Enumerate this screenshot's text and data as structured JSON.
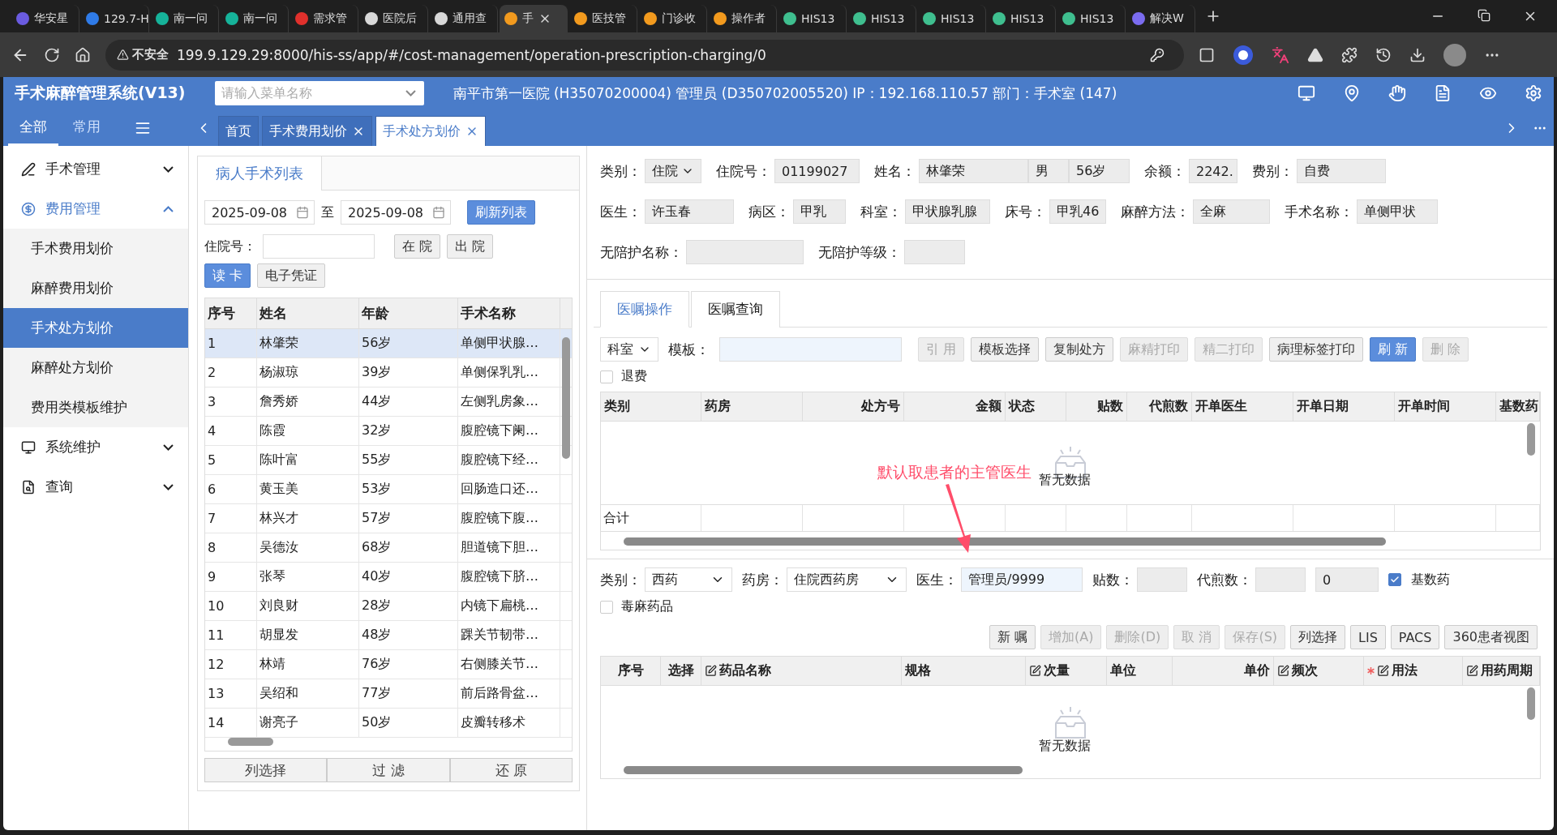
{
  "browser": {
    "tabs": [
      {
        "title": "华安星",
        "color": "#6a5be0",
        "selected": false
      },
      {
        "title": "129.7-H",
        "color": "#2f7be8",
        "selected": false
      },
      {
        "title": "南一问",
        "color": "#16b39a",
        "selected": false
      },
      {
        "title": "南一问",
        "color": "#16b39a",
        "selected": false
      },
      {
        "title": "需求管",
        "color": "#e0302c",
        "selected": false
      },
      {
        "title": "医院后",
        "color": "#d8d8d8",
        "selected": false
      },
      {
        "title": "通用查",
        "color": "#d8d8d8",
        "selected": false
      },
      {
        "title": "手",
        "color": "#f29a1e",
        "selected": true
      },
      {
        "title": "医技管",
        "color": "#f29a1e",
        "selected": false
      },
      {
        "title": "门诊收",
        "color": "#f29a1e",
        "selected": false
      },
      {
        "title": "操作者",
        "color": "#f29a1e",
        "selected": false
      },
      {
        "title": "HIS13",
        "color": "#3fbf8f",
        "selected": false
      },
      {
        "title": "HIS13",
        "color": "#3fbf8f",
        "selected": false
      },
      {
        "title": "HIS13",
        "color": "#3fbf8f",
        "selected": false
      },
      {
        "title": "HIS13",
        "color": "#3fbf8f",
        "selected": false
      },
      {
        "title": "HIS13",
        "color": "#3fbf8f",
        "selected": false
      },
      {
        "title": "解决W",
        "color": "#7b6cf0",
        "selected": false
      }
    ],
    "security": "不安全",
    "url": "199.9.129.29:8000/his-ss/app/#/cost-management/operation-prescription-charging/0"
  },
  "app": {
    "title": "手术麻醉管理系统(V13)",
    "menu_search": {
      "placeholder": "请输入菜单名称"
    },
    "info": "南平市第一医院 (H35070200004) 管理员 (D350702005520) IP：192.168.110.57 部门：手术室 (147)"
  },
  "nav_tabs": [
    {
      "label": "全部",
      "selected": true
    },
    {
      "label": "常用",
      "selected": false
    }
  ],
  "page_tabs": [
    {
      "label": "首页",
      "closable": false,
      "selected": false
    },
    {
      "label": "手术费用划价",
      "closable": true,
      "selected": false
    },
    {
      "label": "手术处方划价",
      "closable": true,
      "selected": true
    }
  ],
  "sidebar": {
    "items": [
      {
        "label": "手术管理",
        "expanded": false,
        "selected": false
      },
      {
        "label": "费用管理",
        "expanded": true,
        "selected": true,
        "children": [
          {
            "label": "手术费用划价",
            "selected": false
          },
          {
            "label": "麻醉费用划价",
            "selected": false
          },
          {
            "label": "手术处方划价",
            "selected": true
          },
          {
            "label": "麻醉处方划价",
            "selected": false
          },
          {
            "label": "费用类模板维护",
            "selected": false
          }
        ]
      },
      {
        "label": "系统维护",
        "expanded": false,
        "selected": false
      },
      {
        "label": "查询",
        "expanded": false,
        "selected": false
      }
    ]
  },
  "patient_panel": {
    "tab": "病人手术列表",
    "date_from": "2025-09-08",
    "date_sep": "至",
    "date_to": "2025-09-08",
    "refresh_button": "刷新列表",
    "inpatient_label": "住院号：",
    "buttons": [
      {
        "label": "在 院",
        "primary": false
      },
      {
        "label": "出 院",
        "primary": false
      },
      {
        "label": "读 卡",
        "primary": true
      },
      {
        "label": "电子凭证",
        "primary": false
      }
    ],
    "table": {
      "columns": [
        "序号",
        "姓名",
        "年龄",
        "手术名称"
      ],
      "rows": [
        {
          "cells": [
            "1",
            "林肇荣",
            "56岁",
            "单侧甲状腺…"
          ],
          "selected": true
        },
        {
          "cells": [
            "2",
            "杨淑琼",
            "39岁",
            "单侧保乳乳…"
          ],
          "selected": false
        },
        {
          "cells": [
            "3",
            "詹秀娇",
            "44岁",
            "左侧乳房象…"
          ],
          "selected": false
        },
        {
          "cells": [
            "4",
            "陈霞",
            "32岁",
            "腹腔镜下阑…"
          ],
          "selected": false
        },
        {
          "cells": [
            "5",
            "陈叶富",
            "55岁",
            "腹腔镜下经…"
          ],
          "selected": false
        },
        {
          "cells": [
            "6",
            "黄玉美",
            "53岁",
            "回肠造口还…"
          ],
          "selected": false
        },
        {
          "cells": [
            "7",
            "林兴才",
            "57岁",
            "腹腔镜下腹…"
          ],
          "selected": false
        },
        {
          "cells": [
            "8",
            "吴德汝",
            "68岁",
            "胆道镜下胆…"
          ],
          "selected": false
        },
        {
          "cells": [
            "9",
            "张琴",
            "40岁",
            "腹腔镜下脐…"
          ],
          "selected": false
        },
        {
          "cells": [
            "10",
            "刘良财",
            "28岁",
            "内镜下扁桃…"
          ],
          "selected": false
        },
        {
          "cells": [
            "11",
            "胡显发",
            "48岁",
            "踝关节韧带…"
          ],
          "selected": false
        },
        {
          "cells": [
            "12",
            "林靖",
            "76岁",
            "右侧膝关节…"
          ],
          "selected": false
        },
        {
          "cells": [
            "13",
            "吴绍和",
            "77岁",
            "前后路骨盆…"
          ],
          "selected": false
        },
        {
          "cells": [
            "14",
            "谢亮子",
            "50岁",
            "皮瓣转移术"
          ],
          "selected": false
        }
      ]
    },
    "footer_buttons": [
      "列选择",
      "过 滤",
      "还 原"
    ]
  },
  "patient_info": {
    "fields": [
      {
        "label": "类别：",
        "kind": "select",
        "value": "住院"
      },
      {
        "label": "住院号：",
        "kind": "text",
        "value": "01199027"
      },
      {
        "label": "姓名：",
        "kind": "group",
        "values": [
          "林肇荣",
          "男",
          "56岁"
        ]
      },
      {
        "label": "余额：",
        "kind": "text",
        "value": "2242."
      },
      {
        "label": "费别：",
        "kind": "text",
        "value": "自费"
      },
      {
        "label": "医生：",
        "kind": "text",
        "value": "许玉春"
      },
      {
        "label": "病区：",
        "kind": "text",
        "value": "甲乳"
      },
      {
        "label": "科室：",
        "kind": "text",
        "value": "甲状腺乳腺"
      },
      {
        "label": "床号：",
        "kind": "text",
        "value": "甲乳46"
      },
      {
        "label": "麻醉方法：",
        "kind": "text",
        "value": "全麻"
      },
      {
        "label": "手术名称：",
        "kind": "text",
        "value": "单侧甲状"
      },
      {
        "label": "无陪护名称：",
        "kind": "text"
      },
      {
        "label": "无陪护等级：",
        "kind": "text"
      }
    ]
  },
  "order_tabs": [
    {
      "label": "医嘱操作",
      "selected": true
    },
    {
      "label": "医嘱查询",
      "selected": false
    }
  ],
  "order_toolbar": {
    "dept_select": "科室",
    "template_label": "模板：",
    "buttons": [
      {
        "label": "引 用",
        "disabled": true,
        "primary": false
      },
      {
        "label": "模板选择",
        "disabled": false,
        "primary": false
      },
      {
        "label": "复制处方",
        "disabled": false,
        "primary": false
      },
      {
        "label": "麻精打印",
        "disabled": true,
        "primary": false
      },
      {
        "label": "精二打印",
        "disabled": true,
        "primary": false
      },
      {
        "label": "病理标签打印",
        "disabled": false,
        "primary": false
      },
      {
        "label": "刷 新",
        "disabled": false,
        "primary": true
      },
      {
        "label": "删 除",
        "disabled": true,
        "primary": false
      }
    ],
    "refund": {
      "label": "退费",
      "checked": false
    }
  },
  "prescription_grid": {
    "columns": [
      "类别",
      "药房",
      "处方号",
      "金额",
      "状态",
      "贴数",
      "代煎数",
      "开单医生",
      "开单日期",
      "开单时间",
      "基数药"
    ],
    "empty_text": "暂无数据",
    "total_label": "合计"
  },
  "annotation": "默认取患者的主管医生",
  "order_form": {
    "fields": [
      {
        "label": "类别：",
        "kind": "select",
        "value": "西药"
      },
      {
        "label": "药房：",
        "kind": "select",
        "value": "住院西药房"
      },
      {
        "label": "医生：",
        "kind": "input",
        "value": "管理员/9999"
      },
      {
        "label": "贴数：",
        "kind": "text"
      },
      {
        "label": "代煎数：",
        "kind": "text"
      },
      {
        "kind": "text",
        "value": "0"
      }
    ],
    "checks": [
      {
        "label": "基数药",
        "checked": true
      },
      {
        "label": "毒麻药品",
        "checked": false
      }
    ],
    "buttons": [
      {
        "label": "新 嘱",
        "disabled": false
      },
      {
        "label": "增加(A)",
        "disabled": true
      },
      {
        "label": "删除(D)",
        "disabled": true
      },
      {
        "label": "取 消",
        "disabled": true
      },
      {
        "label": "保存(S)",
        "disabled": true
      },
      {
        "label": "列选择",
        "disabled": false
      },
      {
        "label": "LIS",
        "disabled": false
      },
      {
        "label": "PACS",
        "disabled": false
      },
      {
        "label": "360患者视图",
        "disabled": false
      }
    ]
  },
  "drug_grid": {
    "columns": [
      {
        "label": "序号",
        "editable": false,
        "required": false
      },
      {
        "label": "选择",
        "editable": false,
        "required": false
      },
      {
        "label": "药品名称",
        "editable": true,
        "required": false
      },
      {
        "label": "规格",
        "editable": false,
        "required": false
      },
      {
        "label": "次量",
        "editable": true,
        "required": false
      },
      {
        "label": "单位",
        "editable": false,
        "required": false
      },
      {
        "label": "单价",
        "editable": false,
        "required": false
      },
      {
        "label": "频次",
        "editable": true,
        "required": false
      },
      {
        "label": "用法",
        "editable": true,
        "required": true
      },
      {
        "label": "用药周期",
        "editable": true,
        "required": false
      }
    ],
    "empty_text": "暂无数据"
  }
}
